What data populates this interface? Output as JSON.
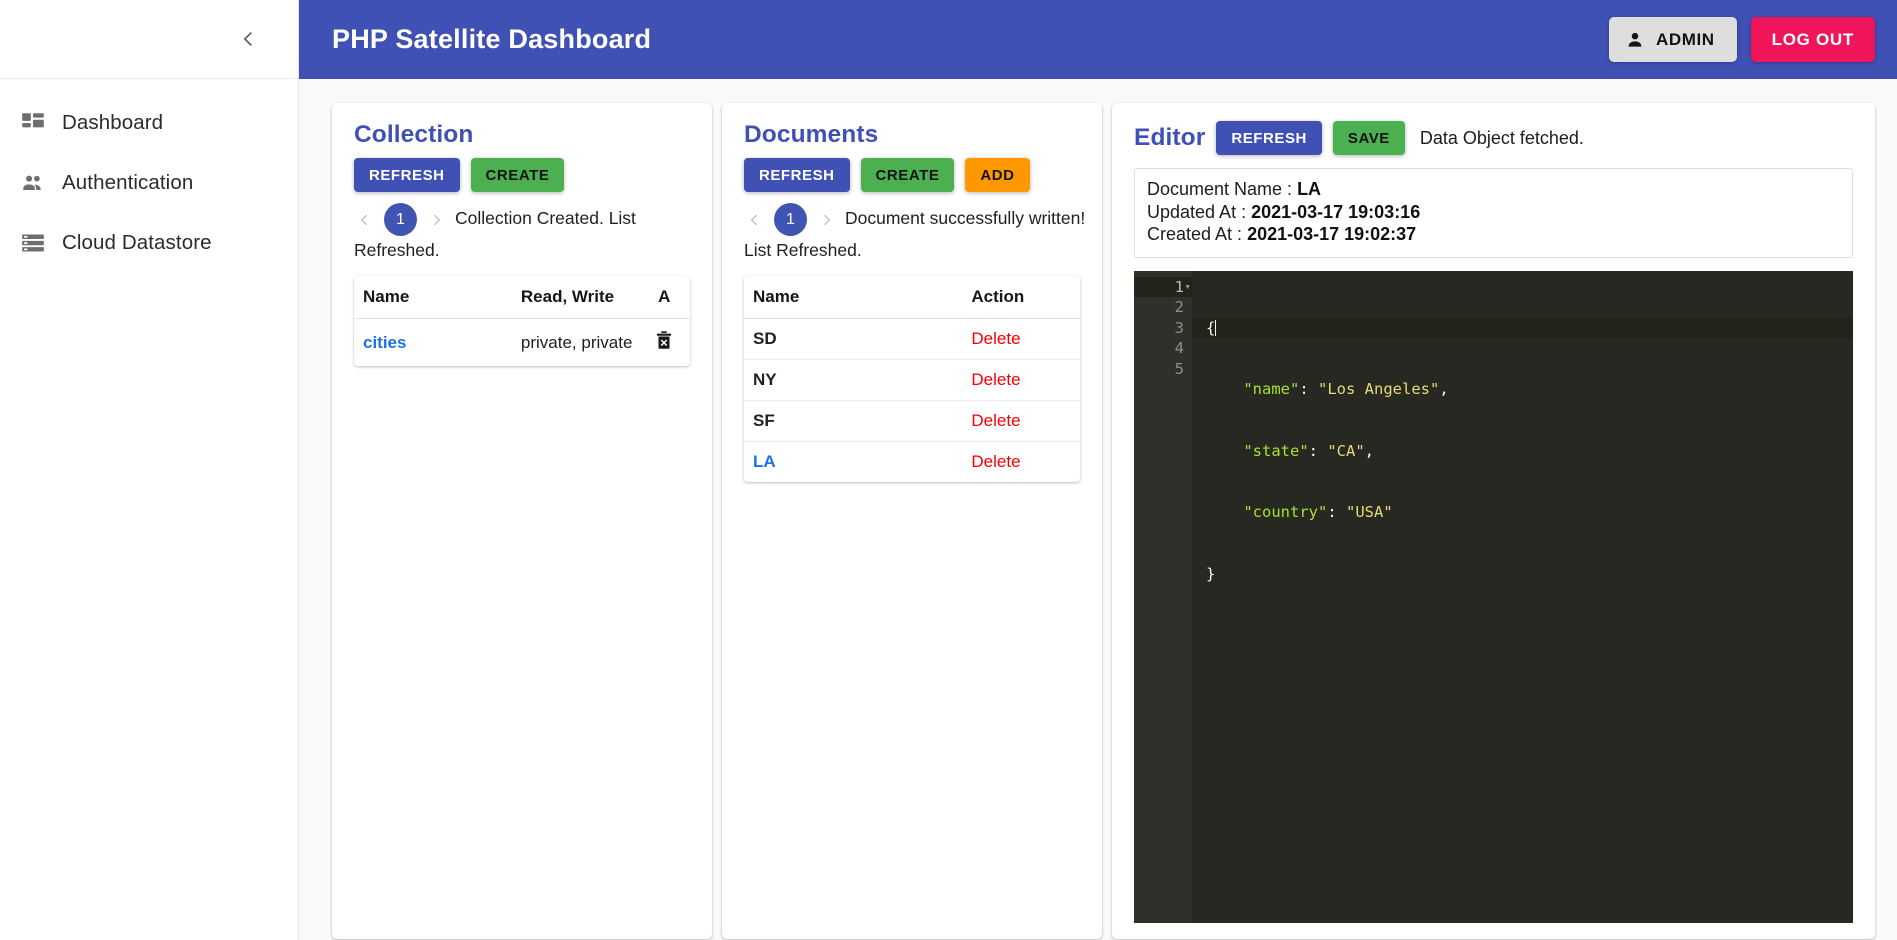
{
  "sidebar": {
    "collapse_icon": "chevron-left-icon",
    "items": [
      {
        "label": "Dashboard",
        "icon": "dashboard-grid-icon"
      },
      {
        "label": "Authentication",
        "icon": "people-group-icon"
      },
      {
        "label": "Cloud Datastore",
        "icon": "storage-database-icon"
      }
    ]
  },
  "topbar": {
    "title": "PHP Satellite Dashboard",
    "admin_label": "ADMIN",
    "admin_icon": "person-icon",
    "logout_label": "LOG OUT",
    "bar_color": "#3f51b5",
    "logout_color": "#f0145a"
  },
  "collection": {
    "title": "Collection",
    "buttons": [
      {
        "label": "REFRESH",
        "style": "primary"
      },
      {
        "label": "CREATE",
        "style": "success"
      }
    ],
    "pager": {
      "prev": "‹",
      "page": "1",
      "next": "›"
    },
    "status": "Collection Created. List Refreshed.",
    "columns": [
      "Name",
      "Read, Write",
      "A"
    ],
    "rows": [
      {
        "name": "cities",
        "rw": "private, private",
        "action_icon": "trash-delete-icon"
      }
    ]
  },
  "documents": {
    "title": "Documents",
    "buttons": [
      {
        "label": "REFRESH",
        "style": "primary"
      },
      {
        "label": "CREATE",
        "style": "success"
      },
      {
        "label": "ADD",
        "style": "warn"
      }
    ],
    "pager": {
      "prev": "‹",
      "page": "1",
      "next": "›"
    },
    "status": "Document successfully written! List Refreshed.",
    "columns": [
      "Name",
      "Action"
    ],
    "rows": [
      {
        "name": "SD",
        "action": "Delete",
        "selected": false
      },
      {
        "name": "NY",
        "action": "Delete",
        "selected": false
      },
      {
        "name": "SF",
        "action": "Delete",
        "selected": false
      },
      {
        "name": "LA",
        "action": "Delete",
        "selected": true
      }
    ]
  },
  "editor": {
    "title": "Editor",
    "refresh_label": "REFRESH",
    "save_label": "SAVE",
    "note": "Data Object fetched.",
    "meta": {
      "doc_name_label": "Document Name : ",
      "doc_name_value": "LA",
      "updated_label": "Updated At : ",
      "updated_value": "2021-03-17 19:03:16",
      "created_label": "Created At : ",
      "created_value": "2021-03-17 19:02:37"
    },
    "code_lines": [
      "1",
      "2",
      "3",
      "4",
      "5"
    ],
    "code": {
      "l1": "{",
      "l2_key": "\"name\"",
      "l2_val": "\"Los Angeles\"",
      "l3_key": "\"state\"",
      "l3_val": "\"CA\"",
      "l4_key": "\"country\"",
      "l4_val": "\"USA\"",
      "l5": "}",
      "colon": ": ",
      "comma": ","
    },
    "theme": {
      "bg": "#272822",
      "gutter": "#2f302a",
      "key": "#a6e22e",
      "value": "#e6db74",
      "punct": "#f8f8f2"
    }
  }
}
